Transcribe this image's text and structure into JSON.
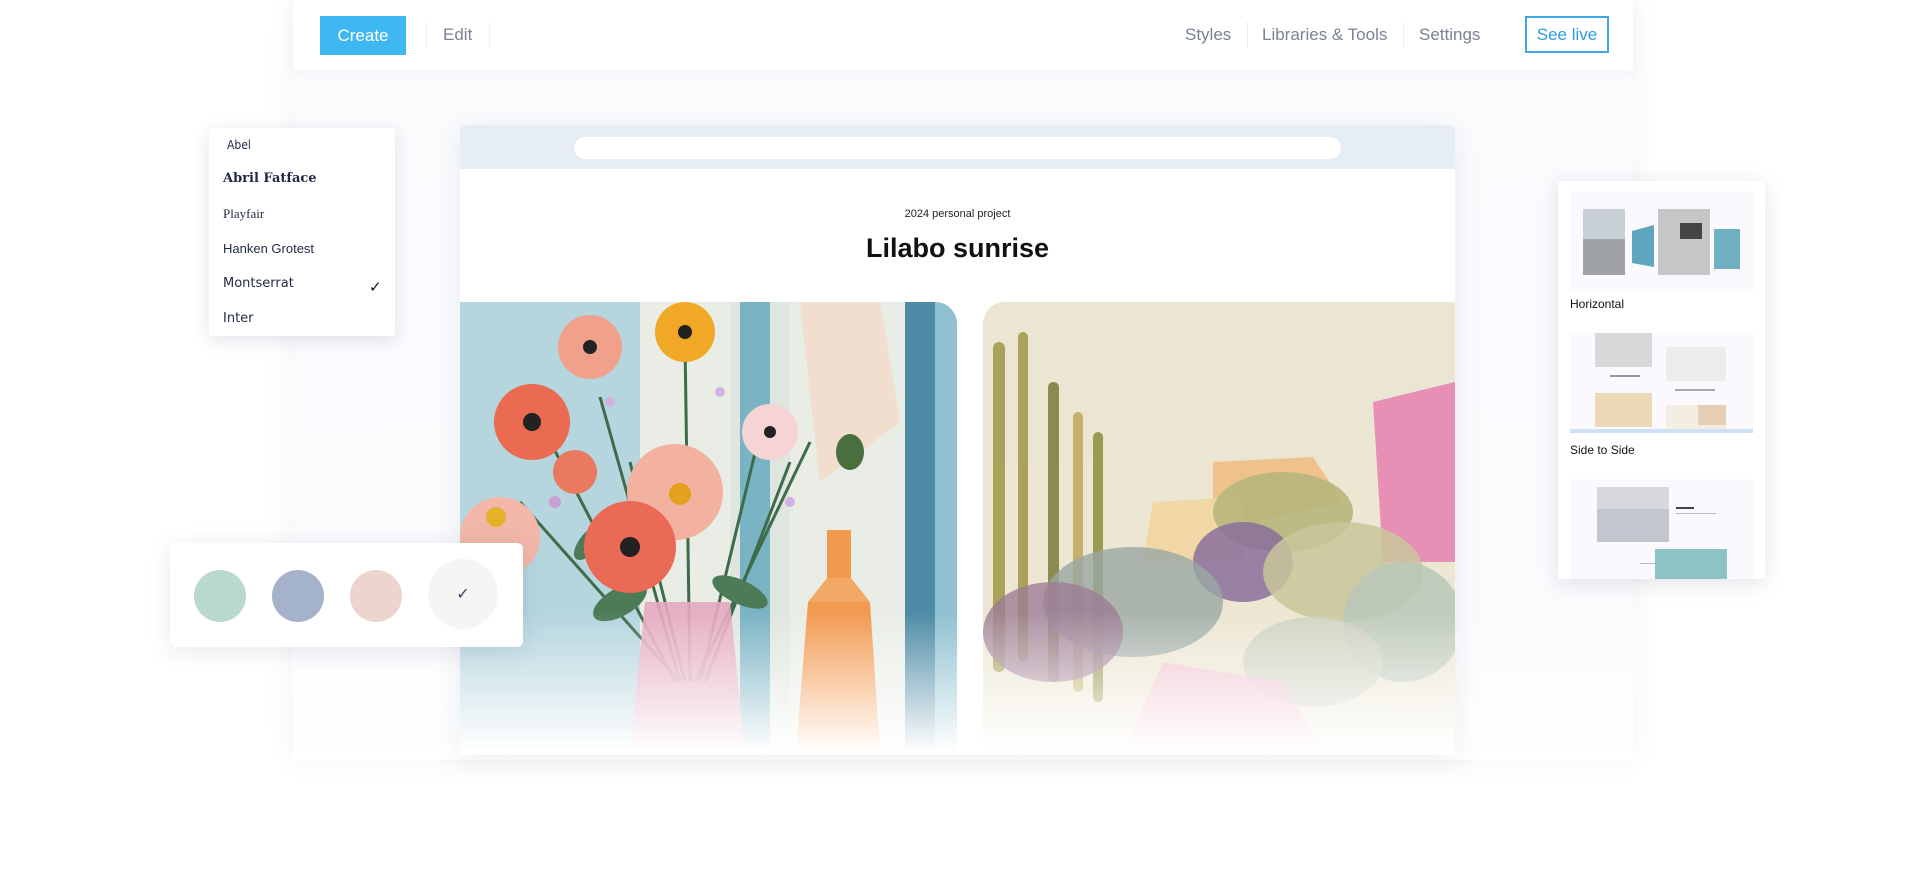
{
  "toolbar": {
    "create_label": "Create",
    "edit_label": "Edit",
    "styles_label": "Styles",
    "libraries_label": "Libraries & Tools",
    "settings_label": "Settings",
    "see_live_label": "See live"
  },
  "preview": {
    "subtitle": "2024 personal project",
    "title": "Lilabo sunrise"
  },
  "font_menu": {
    "items": [
      "Abel",
      "Abril Fatface",
      "Playfair",
      "Hanken Grotest",
      "Montserrat",
      "Inter"
    ],
    "selected": "Montserrat"
  },
  "palette": {
    "swatches": [
      "#b9d8ce",
      "#a5b2cb",
      "#ecd5cc"
    ],
    "selected_background": "#f5f5f3"
  },
  "layouts": {
    "items": [
      "Horizontal",
      "Side to Side"
    ]
  },
  "colors": {
    "accent": "#3fb8f2",
    "see_live_border": "#3fa9e6"
  },
  "icons": [
    "check-icon",
    "selected-swatch-check-icon"
  ]
}
